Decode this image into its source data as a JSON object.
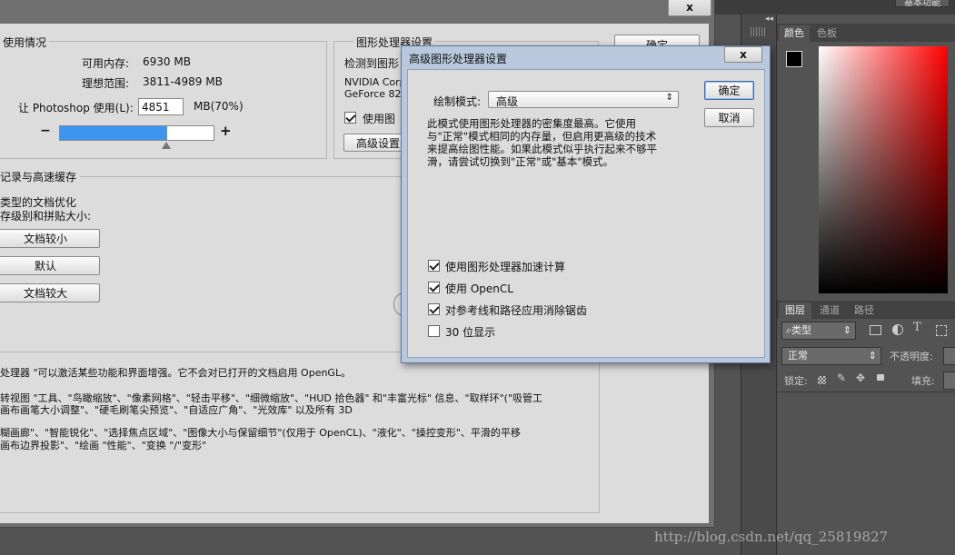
{
  "app": {
    "top_right_label": "基本功能",
    "panel_collapse_icon": "double-chevron-left",
    "color_tab": "颜色",
    "swatch_tab": "色板",
    "layers_tab": "图层",
    "channels_tab": "通道",
    "paths_tab": "路径",
    "kind_label": "类型",
    "blend_mode": "正常",
    "opacity_label": "不透明度:",
    "lock_label": "锁定:",
    "fill_label": "填充:"
  },
  "prefs": {
    "close_glyph": "x",
    "ok_label": "确定",
    "memory": {
      "title": "使用情况",
      "available_label": "可用内存:",
      "available_value": "6930 MB",
      "ideal_label": "理想范围:",
      "ideal_value": "3811-4989 MB",
      "let_ps_label": "让 Photoshop 使用(L):",
      "use_value": "4851",
      "use_unit": "MB(70%)",
      "minus": "−",
      "plus": "+",
      "slider_fraction": 0.7
    },
    "gpu": {
      "title": "图形处理器设置",
      "detected_label": "检测到图形",
      "card_line1": "NVIDIA Corp",
      "card_line2": "GeForce 820",
      "use_gpu_label": "使用图",
      "use_gpu_checked": true,
      "advanced_button": "高级设置"
    },
    "cache": {
      "title": "记录与高速缓存",
      "optimize_line1": "类型的文档优化",
      "optimize_line2": "存级别和拼贴大小:",
      "btn_small": "文档较小",
      "btn_default": "默认",
      "btn_large": "文档较大"
    },
    "description": {
      "line1": "处理器 \"可以激活某些功能和界面增强。它不会对已打开的文档启用  OpenGL。",
      "line2": "转视图 \"工具、\"鸟瞰缩放\"、\"像素网格\"、\"轻击平移\"、\"细微缩放\"、\"HUD 拾色器\" 和\"丰富光标\" 信息、\"取样环\"(\"吸管工",
      "line3": "画布画笔大小调整\"、\"硬毛刷笔尖预览\"、\"自适应广角\"、\"光效库\" 以及所有 3D",
      "line4": "糊画廊\"、\"智能锐化\"、\"选择焦点区域\"、\"图像大小与保留细节\"(仅用于 OpenCL)、\"液化\"、\"操控变形\"、平滑的平移",
      "line5": "画布边界投影\"、\"绘画 \"性能\"、\"变换 \"/\"变形\""
    }
  },
  "adv": {
    "title": "高级图形处理器设置",
    "close_glyph": "x",
    "draw_mode_label": "绘制模式:",
    "draw_mode_value": "高级",
    "ok": "确定",
    "cancel": "取消",
    "desc_line1": "此模式使用图形处理器的密集度最高。它使用",
    "desc_line2": "与\"正常\"模式相同的内存量，但启用更高级的技术",
    "desc_line3": "来提高绘图性能。如果此模式似乎执行起来不够平",
    "desc_line4": "滑，请尝试切换到\"正常\"或\"基本\"模式。",
    "options": [
      {
        "label": "使用图形处理器加速计算",
        "checked": true
      },
      {
        "label": "使用 OpenCL",
        "checked": true
      },
      {
        "label": "对参考线和路径应用消除锯齿",
        "checked": true
      },
      {
        "label": "30 位显示",
        "checked": false
      }
    ]
  },
  "watermark": "http://blog.csdn.net/qq_25819827"
}
